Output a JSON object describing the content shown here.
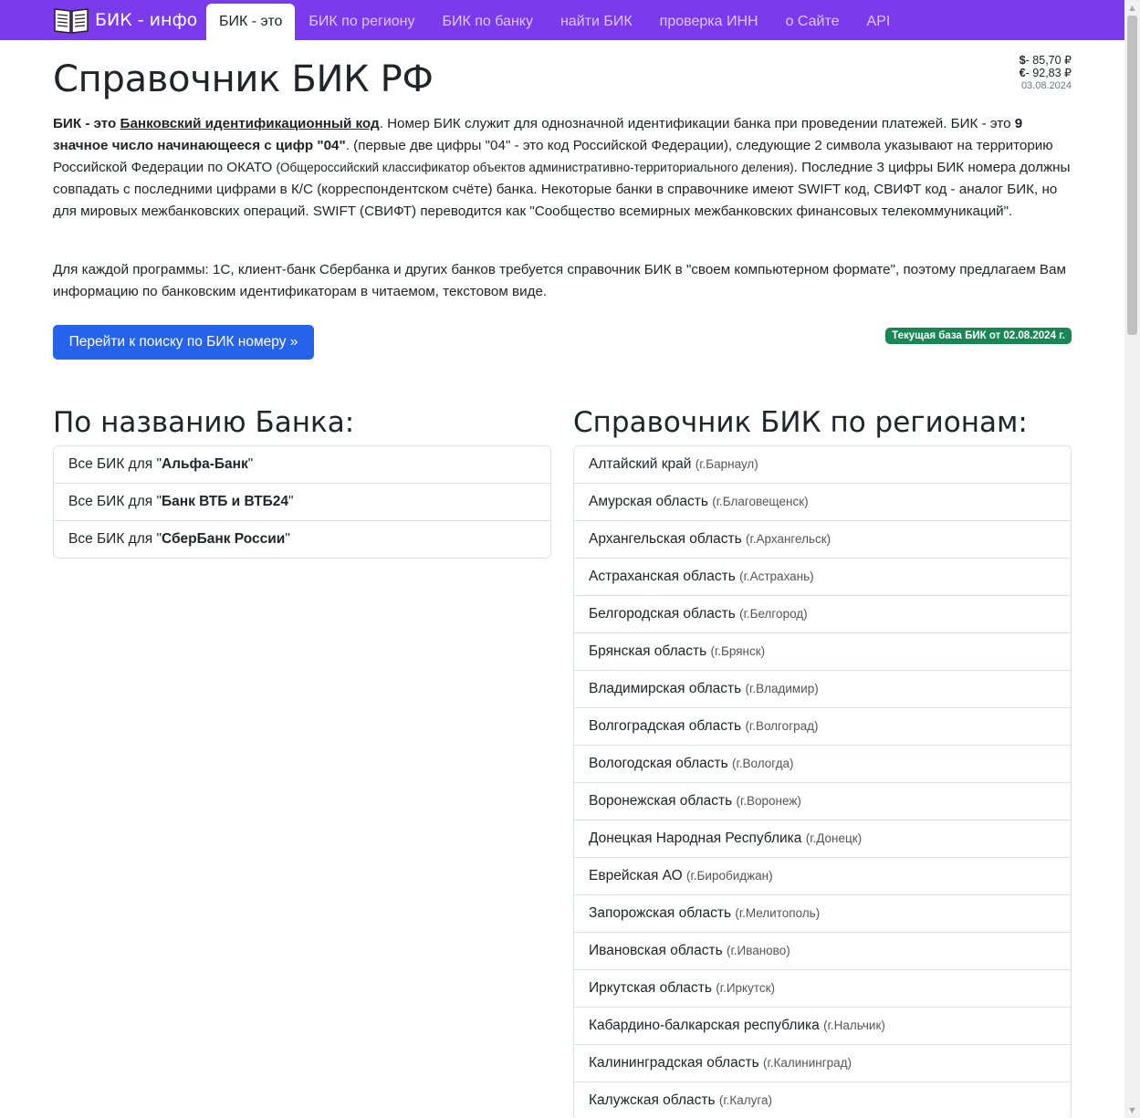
{
  "navbar": {
    "brand": "БИК - инфо",
    "links": [
      {
        "label": "БИК - это",
        "active": true
      },
      {
        "label": "БИК по региону"
      },
      {
        "label": "БИК по банку"
      },
      {
        "label": "найти БИК"
      },
      {
        "label": "проверка ИНН"
      },
      {
        "label": "о Сайте"
      },
      {
        "label": "API"
      }
    ]
  },
  "rates": {
    "usd_symbol": "$",
    "usd_value": "- 85,70 ₽",
    "eur_symbol": "€",
    "eur_value": "- 92,83 ₽",
    "date": "03.08.2024"
  },
  "page": {
    "title": "Справочник БИК РФ",
    "intro_bold1": "БИК - это ",
    "intro_link": "Банковский идентификационный код",
    "intro_text1": ". Номер БИК служит для однозначной идентификации банка при проведении платежей. БИК - это ",
    "intro_bold2": "9 значное число начинающееся с цифр \"04\"",
    "intro_text2": ". (первые две цифры \"04\" - это код Российской Федерации), следующие 2 символа указывают на территорию Российской Федерации по ОКАТО ",
    "intro_small": "(Общероссийский классификатор объектов административно-территориального деления)",
    "intro_text3": ". Последние 3 цифры БИК номера должны совпадать с последними цифрами в К/С (корреспондентском счёте) банка. Некоторые банки в справочнике имеют SWIFT код, СВИФТ код - аналог БИК, но для мировых межбанковских операций. SWIFT (СВИФТ) переводится как \"Сообщество всемирных межбанковских финансовых телекоммуникаций\".",
    "para2": "Для каждой программы: 1С, клиент-банк Сбербанка и других банков требуется справочник БИК в \"своем компьютерном формате\", поэтому предлагаем Вам информацию по банковским идентификаторам в читаемом, текстовом виде.",
    "search_button": "Перейти к поиску по БИК номеру »",
    "badge_prefix": "Текущая база БИК от ",
    "badge_date": "02.08.2024 г."
  },
  "banks": {
    "title": "По названию Банка:",
    "prefix": "Все БИК для \"",
    "suffix": "\"",
    "items": [
      "Альфа-Банк",
      "Банк ВТБ и ВТБ24",
      "СберБанк России"
    ]
  },
  "regions": {
    "title": "Справочник БИК по регионам:",
    "items": [
      {
        "name": "Алтайский край",
        "city": "(г.Барнаул)"
      },
      {
        "name": "Амурская область",
        "city": "(г.Благовещенск)"
      },
      {
        "name": "Архангельская область",
        "city": "(г.Архангельск)"
      },
      {
        "name": "Астраханская область",
        "city": "(г.Астрахань)"
      },
      {
        "name": "Белгородская область",
        "city": "(г.Белгород)"
      },
      {
        "name": "Брянская область",
        "city": "(г.Брянск)"
      },
      {
        "name": "Владимирская область",
        "city": "(г.Владимир)"
      },
      {
        "name": "Волгоградская область",
        "city": "(г.Волгоград)"
      },
      {
        "name": "Вологодская область",
        "city": "(г.Вологда)"
      },
      {
        "name": "Воронежская область",
        "city": "(г.Воронеж)"
      },
      {
        "name": "Донецкая Народная Республика",
        "city": "(г.Донецк)"
      },
      {
        "name": "Еврейская АО",
        "city": "(г.Биробиджан)"
      },
      {
        "name": "Запорожская область",
        "city": "(г.Мелитополь)"
      },
      {
        "name": "Ивановская область",
        "city": "(г.Иваново)"
      },
      {
        "name": "Иркутская область",
        "city": "(г.Иркутск)"
      },
      {
        "name": "Кабардино-балкарская республика",
        "city": "(г.Нальчик)"
      },
      {
        "name": "Калининградская область",
        "city": "(г.Калининград)"
      },
      {
        "name": "Калужская область",
        "city": "(г.Калуга)"
      }
    ]
  },
  "colors": {
    "navbar": "#7c3aed",
    "primary_button": "#2563eb",
    "badge": "#198754"
  }
}
